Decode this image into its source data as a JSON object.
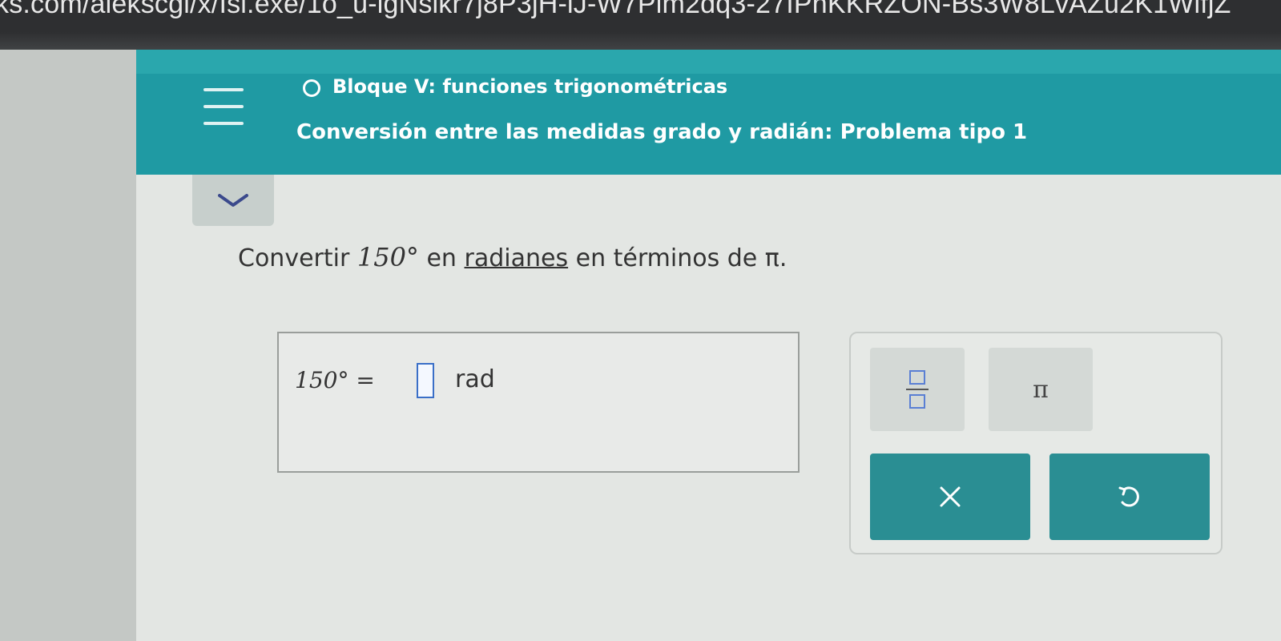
{
  "browser": {
    "url_fragment": "ks.com/alekscgi/x/Isl.exe/1o_u-lgNslkr7j8P3jH-lJ-W7Pim2dq3-27IPhKKRZON-Bs3W8LvAZu2K1WifjZ"
  },
  "header": {
    "block_title": "Bloque V: funciones trigonométricas",
    "problem_title": "Conversión entre las medidas grado y radián: Problema tipo 1",
    "accent_color": "#1f9aa3"
  },
  "question": {
    "prefix": "Convertir",
    "value": "150°",
    "mid": "en",
    "link": "radianes",
    "suffix": "en términos de π."
  },
  "answer": {
    "lhs": "150° =",
    "unit": "rad"
  },
  "keypad": {
    "pi_label": "π",
    "fraction_icon": "fraction-template-icon",
    "clear_icon": "close-icon",
    "undo_icon": "undo-icon",
    "button_color": "#2a8e93"
  }
}
